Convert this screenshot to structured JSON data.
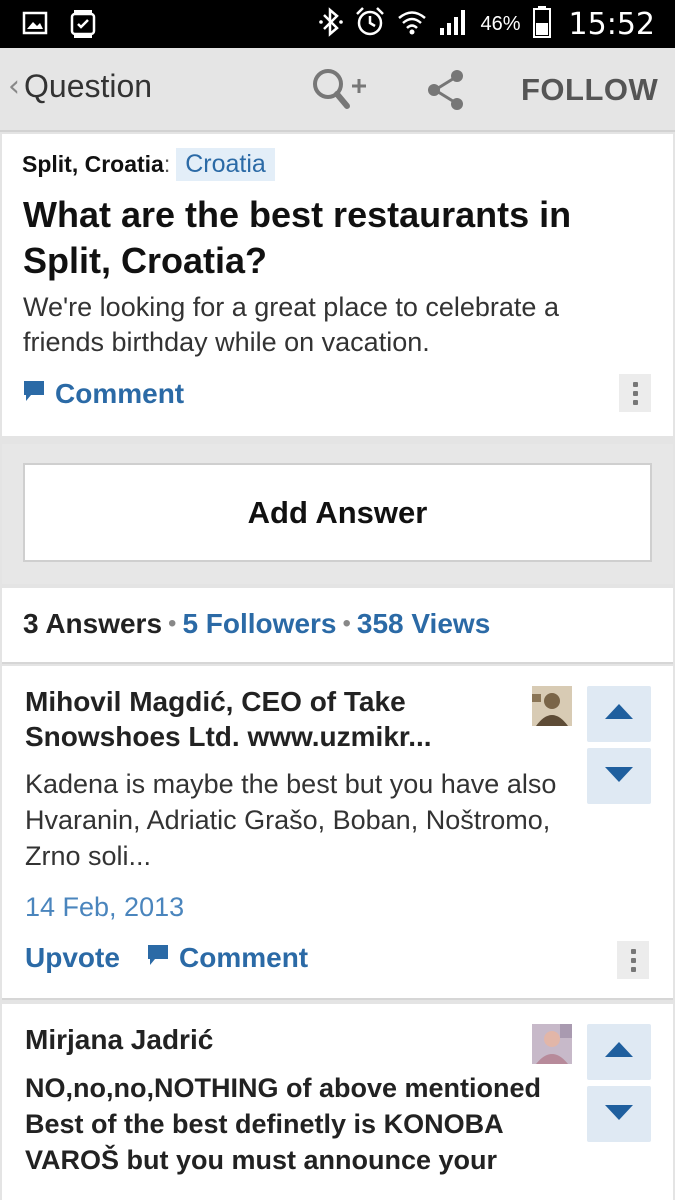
{
  "status_bar": {
    "battery": "46%",
    "time": "15:52",
    "icons": [
      "gallery-icon",
      "watch-icon",
      "bluetooth-icon",
      "alarm-icon",
      "wifi-icon",
      "signal-icon",
      "battery-icon"
    ]
  },
  "app_bar": {
    "back_label": "Question",
    "back_glyph": "‹",
    "follow_label": "FOLLOW",
    "icons": [
      "search-add-icon",
      "share-icon"
    ]
  },
  "question": {
    "topic_parent": "Split, Croatia",
    "topic_colon": ":",
    "topic_tag": "Croatia",
    "title": "What are the best restaurants in Split, Croatia?",
    "detail": "We're looking for a great place to celebrate a friends birthday while on vacation.",
    "comment_label": "Comment"
  },
  "add_answer": {
    "label": "Add Answer"
  },
  "stats": {
    "answers": "3 Answers",
    "followers": "5 Followers",
    "views": "358 Views",
    "separator": "•"
  },
  "answers": [
    {
      "author": "Mihovil Magdić, CEO of Take Snowshoes Ltd. www.uzmikr...",
      "text": "Kadena is maybe the best but you have also Hvaranin, Adriatic Grašo, Boban, Noštromo, Zrno soli...",
      "date": "14 Feb, 2013",
      "upvote_label": "Upvote",
      "comment_label": "Comment"
    },
    {
      "author": "Mirjana Jadrić",
      "text": "NO,no,no,NOTHING of above mentioned Best of the best definetly is KONOBA VAROŠ but you must announce your"
    }
  ],
  "colors": {
    "accent": "#2b6aa6",
    "date": "#4a85bd",
    "vote_bg": "#dfe9f3",
    "app_bar_bg": "#e5e5e5"
  }
}
